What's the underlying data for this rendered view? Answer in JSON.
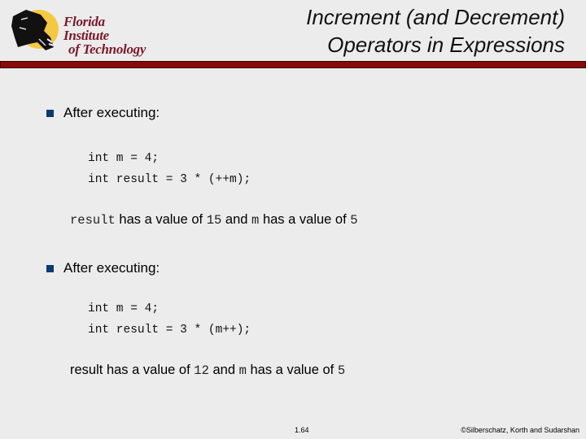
{
  "header": {
    "logo_line1": "Florida Institute",
    "logo_line2": "of Technology",
    "title_line1": "Increment (and Decrement)",
    "title_line2": "Operators in Expressions",
    "accent_color": "#8a0a0a"
  },
  "sections": [
    {
      "bullet": "After executing:",
      "code": [
        "int m = 4;",
        "int result = 3 * (++m);"
      ],
      "result": {
        "var1": "result",
        "var1_mono": true,
        "text1": " has a value of ",
        "val1": "15",
        "text2": " and ",
        "var2": "m",
        "text3": " has a value of ",
        "val2": "5"
      }
    },
    {
      "bullet": "After executing:",
      "code": [
        "int m = 4;",
        "int result = 3 * (m++);"
      ],
      "result": {
        "var1": "result",
        "var1_mono": false,
        "text1": " has a value of ",
        "val1": "12",
        "text2": " and ",
        "var2": "m",
        "text3": " has a value of ",
        "val2": "5"
      }
    }
  ],
  "footer": {
    "page": "1.64",
    "copyright": "©Silberschatz, Korth and Sudarshan"
  }
}
